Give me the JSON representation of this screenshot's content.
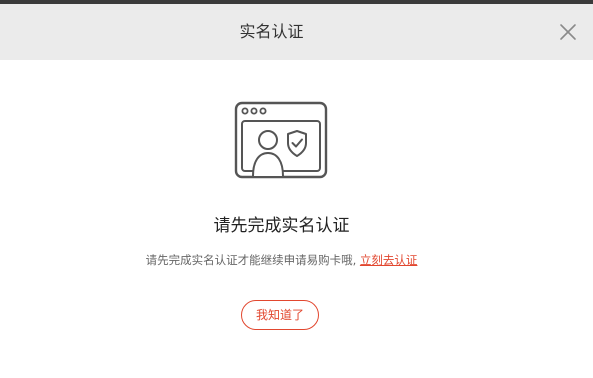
{
  "dialog": {
    "title": "实名认证",
    "close_icon": "close-icon",
    "illustration_icon": "identity-verification-icon",
    "heading": "请先完成实名认证",
    "description": "请先完成实名认证才能继续申请易购卡哦,",
    "link_label": "立刻去认证",
    "ok_label": "我知道了",
    "colors": {
      "accent": "#e2472f",
      "header_bg": "#ebebeb",
      "icon_stroke": "#555555"
    }
  }
}
